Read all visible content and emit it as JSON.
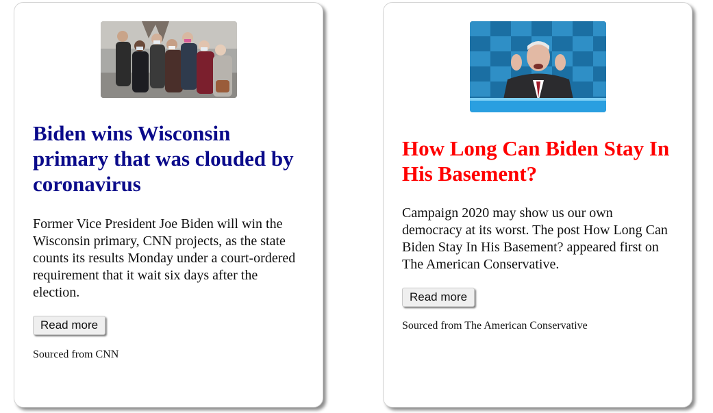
{
  "colors": {
    "headline_1": "#0a0a8a",
    "headline_2": "#ff0000"
  },
  "articles": [
    {
      "image": "photo-people-masks-lined-up",
      "headline": "Biden wins Wisconsin primary that was clouded by coronavirus",
      "summary": "Former Vice President Joe Biden will win the Wisconsin primary, CNN projects, as the state counts its results Monday under a court-ordered requirement that it wait six days after the election.",
      "button_label": "Read more",
      "source": "Sourced from CNN"
    },
    {
      "image": "photo-biden-speaking-at-podium",
      "headline": "How Long Can Biden Stay In His Basement?",
      "summary": "Campaign 2020 may show us our own democracy at its worst. The post How Long Can Biden Stay In His Basement? appeared first on The American Conservative.",
      "button_label": "Read more",
      "source": "Sourced from The American Conservative"
    }
  ]
}
